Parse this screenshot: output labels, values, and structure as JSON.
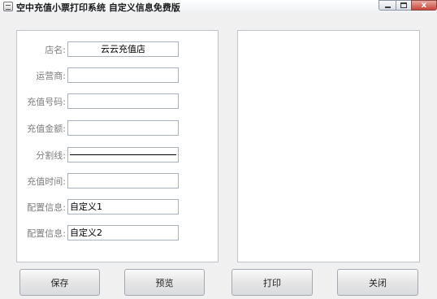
{
  "window": {
    "title": "空中充值小票打印系统 自定义信息免费版",
    "minimize_glyph": "",
    "close_glyph": "x"
  },
  "form": {
    "fields": [
      {
        "label": "店名:",
        "value": "云云充值店"
      },
      {
        "label": "运营商:",
        "value": ""
      },
      {
        "label": "充值号码:",
        "value": ""
      },
      {
        "label": "充值金额:",
        "value": ""
      },
      {
        "label": "分割线:",
        "value": ""
      },
      {
        "label": "充值时间:",
        "value": ""
      },
      {
        "label": "配置信息:",
        "value": "自定义1"
      },
      {
        "label": "配置信息:",
        "value": "自定义2"
      }
    ]
  },
  "buttons": {
    "save": "保存",
    "preview": "预览",
    "print": "打印",
    "close": "关闭"
  },
  "icons": {
    "app": "printer-icon",
    "minimize": "minimize-icon",
    "maximize": "maximize-icon",
    "close": "close-icon"
  }
}
